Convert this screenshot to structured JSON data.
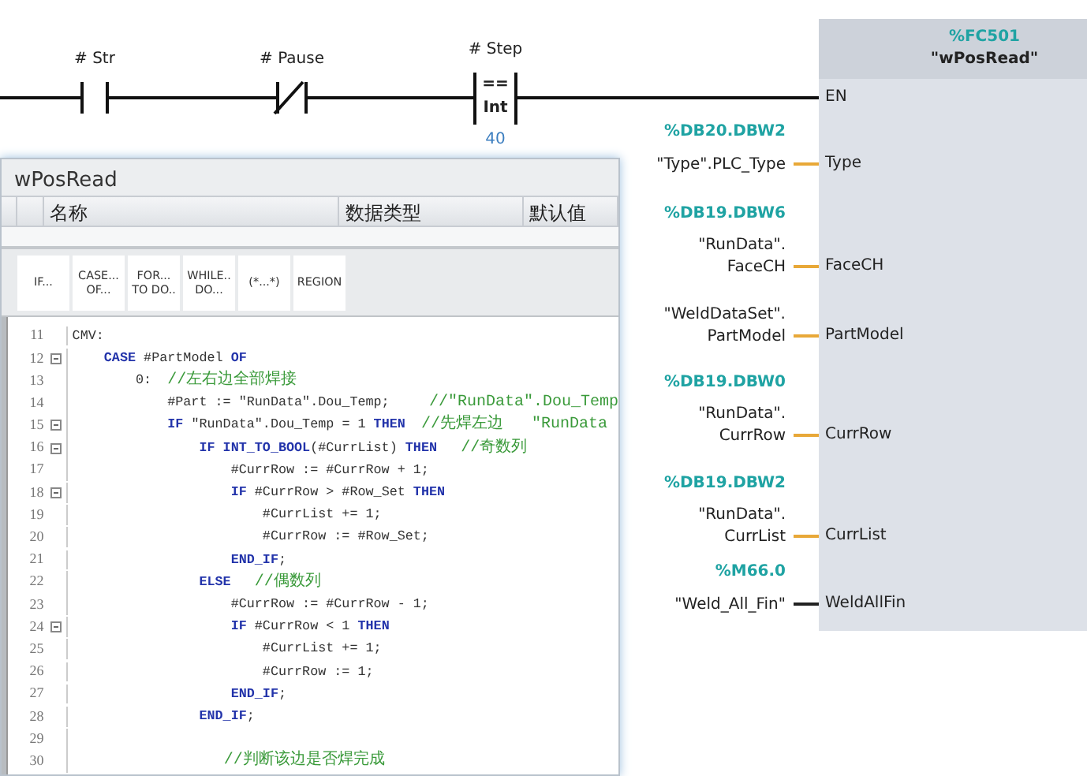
{
  "rung": {
    "contacts": [
      {
        "kind": "no",
        "operand": "# Str"
      },
      {
        "kind": "nc",
        "operand": "# Pause"
      },
      {
        "kind": "compare",
        "operand": "# Step",
        "operator": "==",
        "type": "Int",
        "value": "40"
      }
    ]
  },
  "block": {
    "address": "%FC501",
    "name": "\"wPosRead\"",
    "enable": "EN",
    "pins": [
      {
        "kind": "in",
        "pin": "Type",
        "address": "%DB20.DBW2",
        "operand": [
          "\"Type\".PLC_Type"
        ]
      },
      {
        "kind": "in",
        "pin": "FaceCH",
        "address": "%DB19.DBW6",
        "operand": [
          "\"RunData\".",
          "FaceCH"
        ]
      },
      {
        "kind": "in",
        "pin": "PartModel",
        "operand": [
          "\"WeldDataSet\".",
          "PartModel"
        ]
      },
      {
        "kind": "in",
        "pin": "CurrRow",
        "address": "%DB19.DBW0",
        "operand": [
          "\"RunData\".",
          "CurrRow"
        ]
      },
      {
        "kind": "in",
        "pin": "CurrList",
        "address": "%DB19.DBW2",
        "operand": [
          "\"RunData\".",
          "CurrList"
        ]
      },
      {
        "kind": "out",
        "pin": "WeldAllFin",
        "address": "%M66.0",
        "operand": [
          "\"Weld_All_Fin\""
        ]
      }
    ]
  },
  "editor": {
    "title": "wPosRead",
    "columns": [
      "名称",
      "数据类型",
      "默认值"
    ],
    "toolbar": [
      [
        "IF..."
      ],
      [
        "CASE...",
        "OF..."
      ],
      [
        "FOR...",
        "TO DO.."
      ],
      [
        "WHILE..",
        "DO..."
      ],
      [
        "(*...*)"
      ],
      [
        "REGION"
      ]
    ],
    "lines": [
      {
        "number": "11",
        "foldable": false,
        "tokens": [
          {
            "kind": "tx",
            "text": "CMV:"
          }
        ]
      },
      {
        "number": "12",
        "foldable": true,
        "tokens": [
          {
            "kind": "kw",
            "text": "    CASE"
          },
          {
            "kind": "tx",
            "text": " #PartModel "
          },
          {
            "kind": "kw",
            "text": "OF"
          }
        ]
      },
      {
        "number": "13",
        "foldable": false,
        "tokens": [
          {
            "kind": "tx",
            "text": "        0:  "
          },
          {
            "kind": "cm",
            "text": "//左右边全部焊接"
          }
        ]
      },
      {
        "number": "14",
        "foldable": false,
        "tokens": [
          {
            "kind": "tx",
            "text": "            #Part := \"RunData\".Dou_Temp;     "
          },
          {
            "kind": "cm",
            "text": "//\"RunData\".Dou_Temp"
          }
        ]
      },
      {
        "number": "15",
        "foldable": true,
        "tokens": [
          {
            "kind": "kw",
            "text": "            IF"
          },
          {
            "kind": "tx",
            "text": " \"RunData\".Dou_Temp = 1 "
          },
          {
            "kind": "kw",
            "text": "THEN  "
          },
          {
            "kind": "cm",
            "text": "//先焊左边   \"RunData"
          }
        ]
      },
      {
        "number": "16",
        "foldable": true,
        "tokens": [
          {
            "kind": "kw",
            "text": "                IF INT_TO_BOOL"
          },
          {
            "kind": "tx",
            "text": "(#CurrList) "
          },
          {
            "kind": "kw",
            "text": "THEN   "
          },
          {
            "kind": "cm",
            "text": "//奇数列"
          }
        ]
      },
      {
        "number": "17",
        "foldable": false,
        "tokens": [
          {
            "kind": "tx",
            "text": "                    #CurrRow := #CurrRow + 1;"
          }
        ]
      },
      {
        "number": "18",
        "foldable": true,
        "tokens": [
          {
            "kind": "kw",
            "text": "                    IF"
          },
          {
            "kind": "tx",
            "text": " #CurrRow > #Row_Set "
          },
          {
            "kind": "kw",
            "text": "THEN"
          }
        ]
      },
      {
        "number": "19",
        "foldable": false,
        "tokens": [
          {
            "kind": "tx",
            "text": "                        #CurrList += 1;"
          }
        ]
      },
      {
        "number": "20",
        "foldable": false,
        "tokens": [
          {
            "kind": "tx",
            "text": "                        #CurrRow := #Row_Set;"
          }
        ]
      },
      {
        "number": "21",
        "foldable": false,
        "tokens": [
          {
            "kind": "kw",
            "text": "                    END_IF"
          },
          {
            "kind": "tx",
            "text": ";"
          }
        ]
      },
      {
        "number": "22",
        "foldable": false,
        "tokens": [
          {
            "kind": "kw",
            "text": "                ELSE   "
          },
          {
            "kind": "cm",
            "text": "//偶数列"
          }
        ]
      },
      {
        "number": "23",
        "foldable": false,
        "tokens": [
          {
            "kind": "tx",
            "text": "                    #CurrRow := #CurrRow - 1;"
          }
        ]
      },
      {
        "number": "24",
        "foldable": true,
        "tokens": [
          {
            "kind": "kw",
            "text": "                    IF"
          },
          {
            "kind": "tx",
            "text": " #CurrRow < 1 "
          },
          {
            "kind": "kw",
            "text": "THEN"
          }
        ]
      },
      {
        "number": "25",
        "foldable": false,
        "tokens": [
          {
            "kind": "tx",
            "text": "                        #CurrList += 1;"
          }
        ]
      },
      {
        "number": "26",
        "foldable": false,
        "tokens": [
          {
            "kind": "tx",
            "text": "                        #CurrRow := 1;"
          }
        ]
      },
      {
        "number": "27",
        "foldable": false,
        "tokens": [
          {
            "kind": "kw",
            "text": "                    END_IF"
          },
          {
            "kind": "tx",
            "text": ";"
          }
        ]
      },
      {
        "number": "28",
        "foldable": false,
        "tokens": [
          {
            "kind": "kw",
            "text": "                END_IF"
          },
          {
            "kind": "tx",
            "text": ";"
          }
        ]
      },
      {
        "number": "29",
        "foldable": false
      },
      {
        "number": "30",
        "foldable": false,
        "tokens": [
          {
            "kind": "cm",
            "text": "                //判断该边是否焊完成"
          }
        ]
      }
    ]
  }
}
